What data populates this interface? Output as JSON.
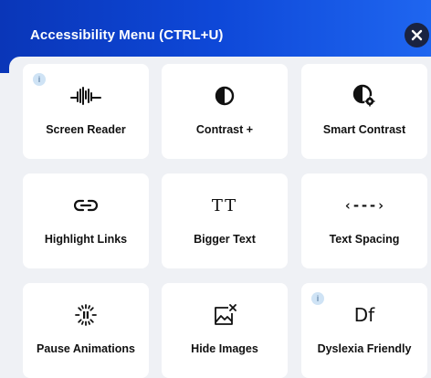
{
  "header": {
    "title": "Accessibility Menu (CTRL+U)"
  },
  "info_badge_text": "i",
  "icons": {
    "screen_reader": "waveform-icon",
    "contrast": "half-circle-icon",
    "smart_contrast": "contrast-gear-icon",
    "highlight_links": "link-icon",
    "bigger_text": "text-size-icon",
    "text_spacing": "text-spacing-icon",
    "pause_animations": "pause-animation-icon",
    "hide_images": "hide-image-icon",
    "dyslexia_friendly": "dyslexia-font-icon"
  },
  "tiles": {
    "screen_reader": "Screen Reader",
    "contrast": "Contrast +",
    "smart_contrast": "Smart Contrast",
    "highlight_links": "Highlight Links",
    "bigger_text": "Bigger Text",
    "text_spacing": "Text Spacing",
    "pause_animations": "Pause Animations",
    "hide_images": "Hide Images",
    "dyslexia_friendly": "Dyslexia Friendly"
  },
  "glyphs": {
    "bigger_text": "TT",
    "text_spacing": "‹---›",
    "dyslexia_friendly": "Df"
  },
  "colors": {
    "header_gradient_start": "#0a36b8",
    "header_gradient_end": "#1f66f0",
    "panel_background": "#eff1f5",
    "tile_background": "#ffffff",
    "info_badge": "#cfe3f5"
  }
}
